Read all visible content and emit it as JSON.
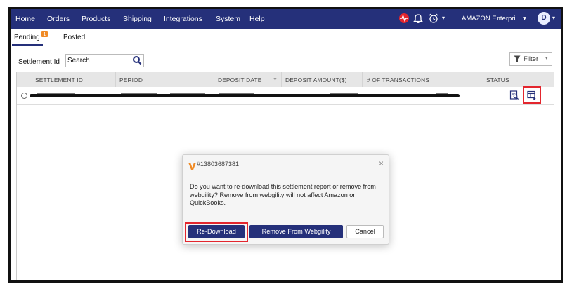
{
  "nav": {
    "items": [
      "Home",
      "Orders",
      "Products",
      "Shipping",
      "Integrations",
      "System",
      "Help"
    ],
    "store_label": "AMAZON Enterpri... ▾",
    "user_initial": "D",
    "alarm_caret": "▾"
  },
  "tabs": {
    "pending_label": "Pending",
    "pending_badge": "1",
    "posted_label": "Posted"
  },
  "filters": {
    "settlement_label": "Settlement Id",
    "search_placeholder": "Search",
    "filter_label": "Filter",
    "filter_caret": "▾"
  },
  "table": {
    "headers": {
      "settlement_id": "SETTLEMENT ID",
      "period": "PERIOD",
      "deposit_date": "DEPOSIT DATE",
      "deposit_amount": "DEPOSIT AMOUNT($)",
      "transactions": "# OF TRANSACTIONS",
      "status": "STATUS"
    },
    "sort_indicator": "▼"
  },
  "modal": {
    "title": "#13803687381",
    "close": "×",
    "message": "Do you want to re-download this settlement report or remove from webgility? Remove from webgility will not affect Amazon or QuickBooks.",
    "redownload_label": "Re-Download",
    "remove_label": "Remove From Webgility",
    "cancel_label": "Cancel"
  },
  "colors": {
    "nav_bg": "#25307a",
    "accent": "#25307a",
    "highlight": "#e3262e",
    "badge": "#f08a24"
  },
  "icons": [
    "signal-alert-icon",
    "bell-icon",
    "alarm-clock-icon",
    "search-icon",
    "filter-funnel-icon",
    "report-view-icon",
    "report-download-icon",
    "webgility-logo-icon",
    "close-icon"
  ]
}
